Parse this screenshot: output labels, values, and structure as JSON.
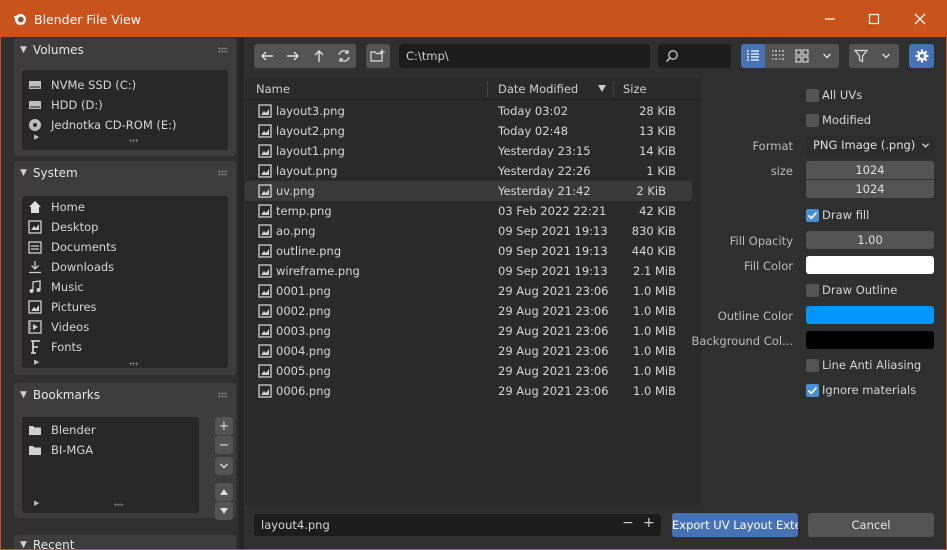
{
  "window": {
    "title": "Blender File View"
  },
  "colors": {
    "titlebar": "#c8531c",
    "accent": "#4772b3",
    "checkbox_on": "#4a8fd4",
    "fill_color": "#ffffff",
    "outline_color": "#0095ff",
    "background_color": "#000000"
  },
  "sidebar": {
    "volumes": {
      "title": "Volumes",
      "items": [
        {
          "label": "NVMe SSD (C:)",
          "icon": "drive-icon"
        },
        {
          "label": "HDD (D:)",
          "icon": "drive-icon"
        },
        {
          "label": "Jednotka CD-ROM (E:)",
          "icon": "disc-icon"
        }
      ]
    },
    "system": {
      "title": "System",
      "items": [
        {
          "label": "Home",
          "icon": "home-icon"
        },
        {
          "label": "Desktop",
          "icon": "desktop-icon"
        },
        {
          "label": "Documents",
          "icon": "documents-icon"
        },
        {
          "label": "Downloads",
          "icon": "downloads-icon"
        },
        {
          "label": "Music",
          "icon": "music-icon"
        },
        {
          "label": "Pictures",
          "icon": "pictures-icon"
        },
        {
          "label": "Videos",
          "icon": "videos-icon"
        },
        {
          "label": "Fonts",
          "icon": "font-icon"
        }
      ]
    },
    "bookmarks": {
      "title": "Bookmarks",
      "items": [
        {
          "label": "Blender",
          "icon": "folder-icon"
        },
        {
          "label": "BI-MGA",
          "icon": "folder-icon"
        }
      ]
    },
    "recent": {
      "title": "Recent"
    }
  },
  "toolbar": {
    "path": "C:\\tmp\\"
  },
  "file_list": {
    "columns": {
      "name": "Name",
      "date": "Date Modified",
      "size": "Size"
    },
    "rows": [
      {
        "name": "layout3.png",
        "date": "Today 03:02",
        "size": "28 KiB"
      },
      {
        "name": "layout2.png",
        "date": "Today 02:48",
        "size": "13 KiB"
      },
      {
        "name": "layout1.png",
        "date": "Yesterday 23:15",
        "size": "14 KiB"
      },
      {
        "name": "layout.png",
        "date": "Yesterday 22:26",
        "size": "1 KiB"
      },
      {
        "name": "uv.png",
        "date": "Yesterday 21:42",
        "size": "2 KiB"
      },
      {
        "name": "temp.png",
        "date": "03 Feb 2022 22:21",
        "size": "42 KiB"
      },
      {
        "name": "ao.png",
        "date": "09 Sep 2021 19:13",
        "size": "830 KiB"
      },
      {
        "name": "outline.png",
        "date": "09 Sep 2021 19:13",
        "size": "440 KiB"
      },
      {
        "name": "wireframe.png",
        "date": "09 Sep 2021 19:13",
        "size": "2.1 MiB"
      },
      {
        "name": "0001.png",
        "date": "29 Aug 2021 23:06",
        "size": "1.0 MiB"
      },
      {
        "name": "0002.png",
        "date": "29 Aug 2021 23:06",
        "size": "1.0 MiB"
      },
      {
        "name": "0003.png",
        "date": "29 Aug 2021 23:06",
        "size": "1.0 MiB"
      },
      {
        "name": "0004.png",
        "date": "29 Aug 2021 23:06",
        "size": "1.0 MiB"
      },
      {
        "name": "0005.png",
        "date": "29 Aug 2021 23:06",
        "size": "1.0 MiB"
      },
      {
        "name": "0006.png",
        "date": "29 Aug 2021 23:06",
        "size": "1.0 MiB"
      }
    ]
  },
  "options": {
    "all_uvs": "All UVs",
    "modified": "Modified",
    "format_label": "Format",
    "format_value": "PNG Image (.png)",
    "size_label": "size",
    "size_x": "1024",
    "size_y": "1024",
    "draw_fill": "Draw fill",
    "fill_opacity_label": "Fill Opacity",
    "fill_opacity_value": "1.00",
    "fill_color_label": "Fill Color",
    "draw_outline": "Draw Outline",
    "outline_color_label": "Outline Color",
    "background_color_label": "Background Col...",
    "line_anti_aliasing": "Line Anti Aliasing",
    "ignore_materials": "Ignore materials"
  },
  "bottom": {
    "filename": "layout4.png",
    "minus": "−",
    "plus": "+",
    "export_label": "Export UV Layout Exte...",
    "cancel_label": "Cancel"
  }
}
